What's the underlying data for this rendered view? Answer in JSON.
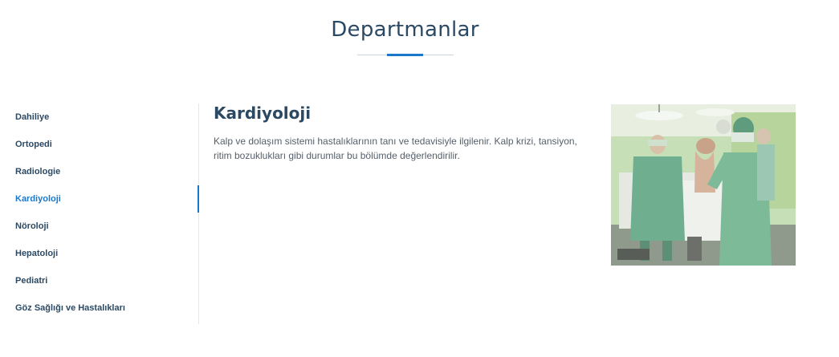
{
  "section": {
    "title": "Departmanlar"
  },
  "nav": {
    "items": [
      {
        "label": "Dahiliye"
      },
      {
        "label": "Ortopedi"
      },
      {
        "label": "Radiologie"
      },
      {
        "label": "Kardiyoloji"
      },
      {
        "label": "Nöroloji"
      },
      {
        "label": "Hepatoloji"
      },
      {
        "label": "Pediatri"
      },
      {
        "label": "Göz Sağlığı ve Hastalıkları"
      }
    ],
    "active": "Kardiyoloji"
  },
  "detail": {
    "title": "Kardiyoloji",
    "description": "Kalp ve dolaşım sistemi hastalıklarının tanı ve tedavisiyle ilgilenir. Kalp krizi, tansiyon, ritim bozuklukları gibi durumlar bu bölümde değerlendirilir."
  },
  "colors": {
    "heading": "#2c4964",
    "accent": "#1977cc",
    "text": "#555f6a"
  }
}
